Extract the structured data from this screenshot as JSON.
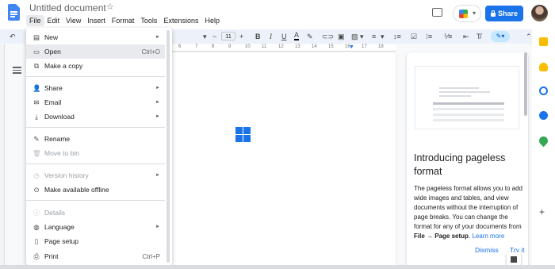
{
  "header": {
    "title": "Untitled document",
    "menus": [
      "File",
      "Edit",
      "View",
      "Insert",
      "Format",
      "Tools",
      "Extensions",
      "Help"
    ],
    "share_label": "Share",
    "icons": [
      "docs-logo",
      "star-icon",
      "comment-icon",
      "meet-icon",
      "lock-icon",
      "avatar"
    ]
  },
  "toolbar": {
    "font_size": "11",
    "icons": [
      "undo-icon",
      "bold-icon",
      "italic-icon",
      "underline-icon",
      "text-color-icon",
      "highlight-icon",
      "link-icon",
      "comment-add-icon",
      "image-icon",
      "align-icon",
      "line-spacing-icon",
      "checklist-icon",
      "bullets-icon",
      "numbered-list-icon",
      "indent-icon",
      "clear-format-icon",
      "edit-mode-icon"
    ]
  },
  "ruler": {
    "ticks": [
      "6",
      "7",
      "8",
      "9",
      "10",
      "11",
      "12",
      "13",
      "14",
      "15",
      "16",
      "17",
      "18"
    ]
  },
  "file_menu": {
    "items": [
      {
        "label": "New",
        "icon": "new-doc-icon",
        "shortcut": "",
        "submenu": true,
        "disabled": false
      },
      {
        "label": "Open",
        "icon": "open-folder-icon",
        "shortcut": "Ctrl+O",
        "submenu": false,
        "disabled": false
      },
      {
        "label": "Make a copy",
        "icon": "copy-icon",
        "shortcut": "",
        "submenu": false,
        "disabled": false
      },
      {
        "label": "Share",
        "icon": "share-person-icon",
        "shortcut": "",
        "submenu": true,
        "disabled": false
      },
      {
        "label": "Email",
        "icon": "email-icon",
        "shortcut": "",
        "submenu": true,
        "disabled": false
      },
      {
        "label": "Download",
        "icon": "download-icon",
        "shortcut": "",
        "submenu": true,
        "disabled": false
      },
      {
        "label": "Rename",
        "icon": "rename-icon",
        "shortcut": "",
        "submenu": false,
        "disabled": false
      },
      {
        "label": "Move to bin",
        "icon": "trash-icon",
        "shortcut": "",
        "submenu": false,
        "disabled": true
      },
      {
        "label": "Version history",
        "icon": "history-icon",
        "shortcut": "",
        "submenu": true,
        "disabled": true
      },
      {
        "label": "Make available offline",
        "icon": "offline-icon",
        "shortcut": "",
        "submenu": false,
        "disabled": false
      },
      {
        "label": "Details",
        "icon": "info-icon",
        "shortcut": "",
        "submenu": false,
        "disabled": true
      },
      {
        "label": "Language",
        "icon": "globe-icon",
        "shortcut": "",
        "submenu": true,
        "disabled": false
      },
      {
        "label": "Page setup",
        "icon": "page-setup-icon",
        "shortcut": "",
        "submenu": false,
        "disabled": false
      },
      {
        "label": "Print",
        "icon": "print-icon",
        "shortcut": "Ctrl+P",
        "submenu": false,
        "disabled": false
      }
    ]
  },
  "panel": {
    "title": "Introducing pageless format",
    "body_pre": "The pageless format allows you to add wide images and tables, and view documents without the interruption of page breaks. You can change the format for any of your documents from ",
    "body_bold": "File → Page setup",
    "body_post": ". ",
    "learn_more": "Learn more",
    "dismiss": "Dismiss",
    "try_it": "Try it"
  },
  "right_rail": {
    "icons": [
      "calendar-icon",
      "keep-icon",
      "tasks-icon",
      "contacts-icon",
      "maps-icon",
      "add-icon"
    ]
  },
  "colors": {
    "accent": "#1a73e8",
    "menu_highlight": "#e8eaed",
    "toolbar_bg": "#edf2fa"
  }
}
